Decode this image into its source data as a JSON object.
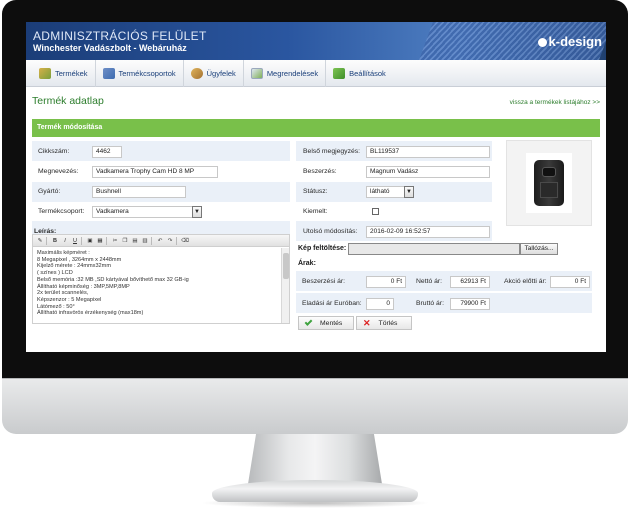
{
  "header": {
    "title": "ADMINISZTRÁCIÓS FELÜLET",
    "subtitle": "Winchester Vadászbolt - Webáruház",
    "logo": "k-design"
  },
  "menu": [
    {
      "label": "Termékek",
      "icon": "products-icon"
    },
    {
      "label": "Termékcsoportok",
      "icon": "product-groups-icon"
    },
    {
      "label": "Ügyfelek",
      "icon": "customers-icon"
    },
    {
      "label": "Megrendelések",
      "icon": "orders-icon"
    },
    {
      "label": "Beállítások",
      "icon": "settings-icon"
    }
  ],
  "page": {
    "title": "Termék adatlap",
    "back_link": "vissza a termékek listájához >>",
    "panel_title": "Termék módosítása"
  },
  "form_left": {
    "cikkszam_label": "Cikkszám:",
    "cikkszam": "4462",
    "megnevezes_label": "Megnevezés:",
    "megnevezes": "Vadkamera Trophy Cam HD 8 MP",
    "gyarto_label": "Gyártó:",
    "gyarto": "Bushnell",
    "termekcsoport_label": "Termékcsoport:",
    "termekcsoport": "Vadkamera",
    "leiras_label": "Leírás:"
  },
  "editor": {
    "toolbar": [
      "B",
      "I",
      "U"
    ],
    "text": "Maximális képméret :\n8 Megapixel , 3264mm x 2448mm\nKijelző mérete : 24mmx32mm\n( színes ) LCD\nBelső memória :32 MB ,SD kártyával bővíthető max 32 GB-ig\nÁllítható képminőség : 3MP,5MP,8MP\n2x terület scannelés,\nKépszenzor : 5 Megapixel\nLátómező : 50°\nÁllítható infravörös érzékenység (max18m)"
  },
  "form_right": {
    "belso_label": "Belső megjegyzés:",
    "belso": "BL119537",
    "beszerzes_label": "Beszerzés:",
    "beszerzes": "Magnum Vadász",
    "statusz_label": "Státusz:",
    "statusz": "látható",
    "kiemelt_label": "Kiemelt:",
    "utolso_label": "Utolsó módosítás:",
    "utolso": "2016-02-09 16:52:57"
  },
  "upload": {
    "label": "Kép feltöltése:",
    "browse": "Tallózás..."
  },
  "prices": {
    "label": "Árak:",
    "beszerzesi_label": "Beszerzési ár:",
    "beszerzesi": "0 Ft",
    "netto_label": "Nettó ár:",
    "netto": "62913 Ft",
    "akcio_label": "Akció előtti ár:",
    "akcio": "0 Ft",
    "eladasi_label": "Eladási ár Euróban:",
    "eladasi": "0",
    "brutto_label": "Bruttó ár:",
    "brutto": "79900 Ft"
  },
  "buttons": {
    "save": "Mentés",
    "delete": "Törlés"
  },
  "colors": {
    "accent_green": "#79c04a",
    "title_green": "#2c7d2c",
    "banner_blue": "#2a56a0"
  }
}
